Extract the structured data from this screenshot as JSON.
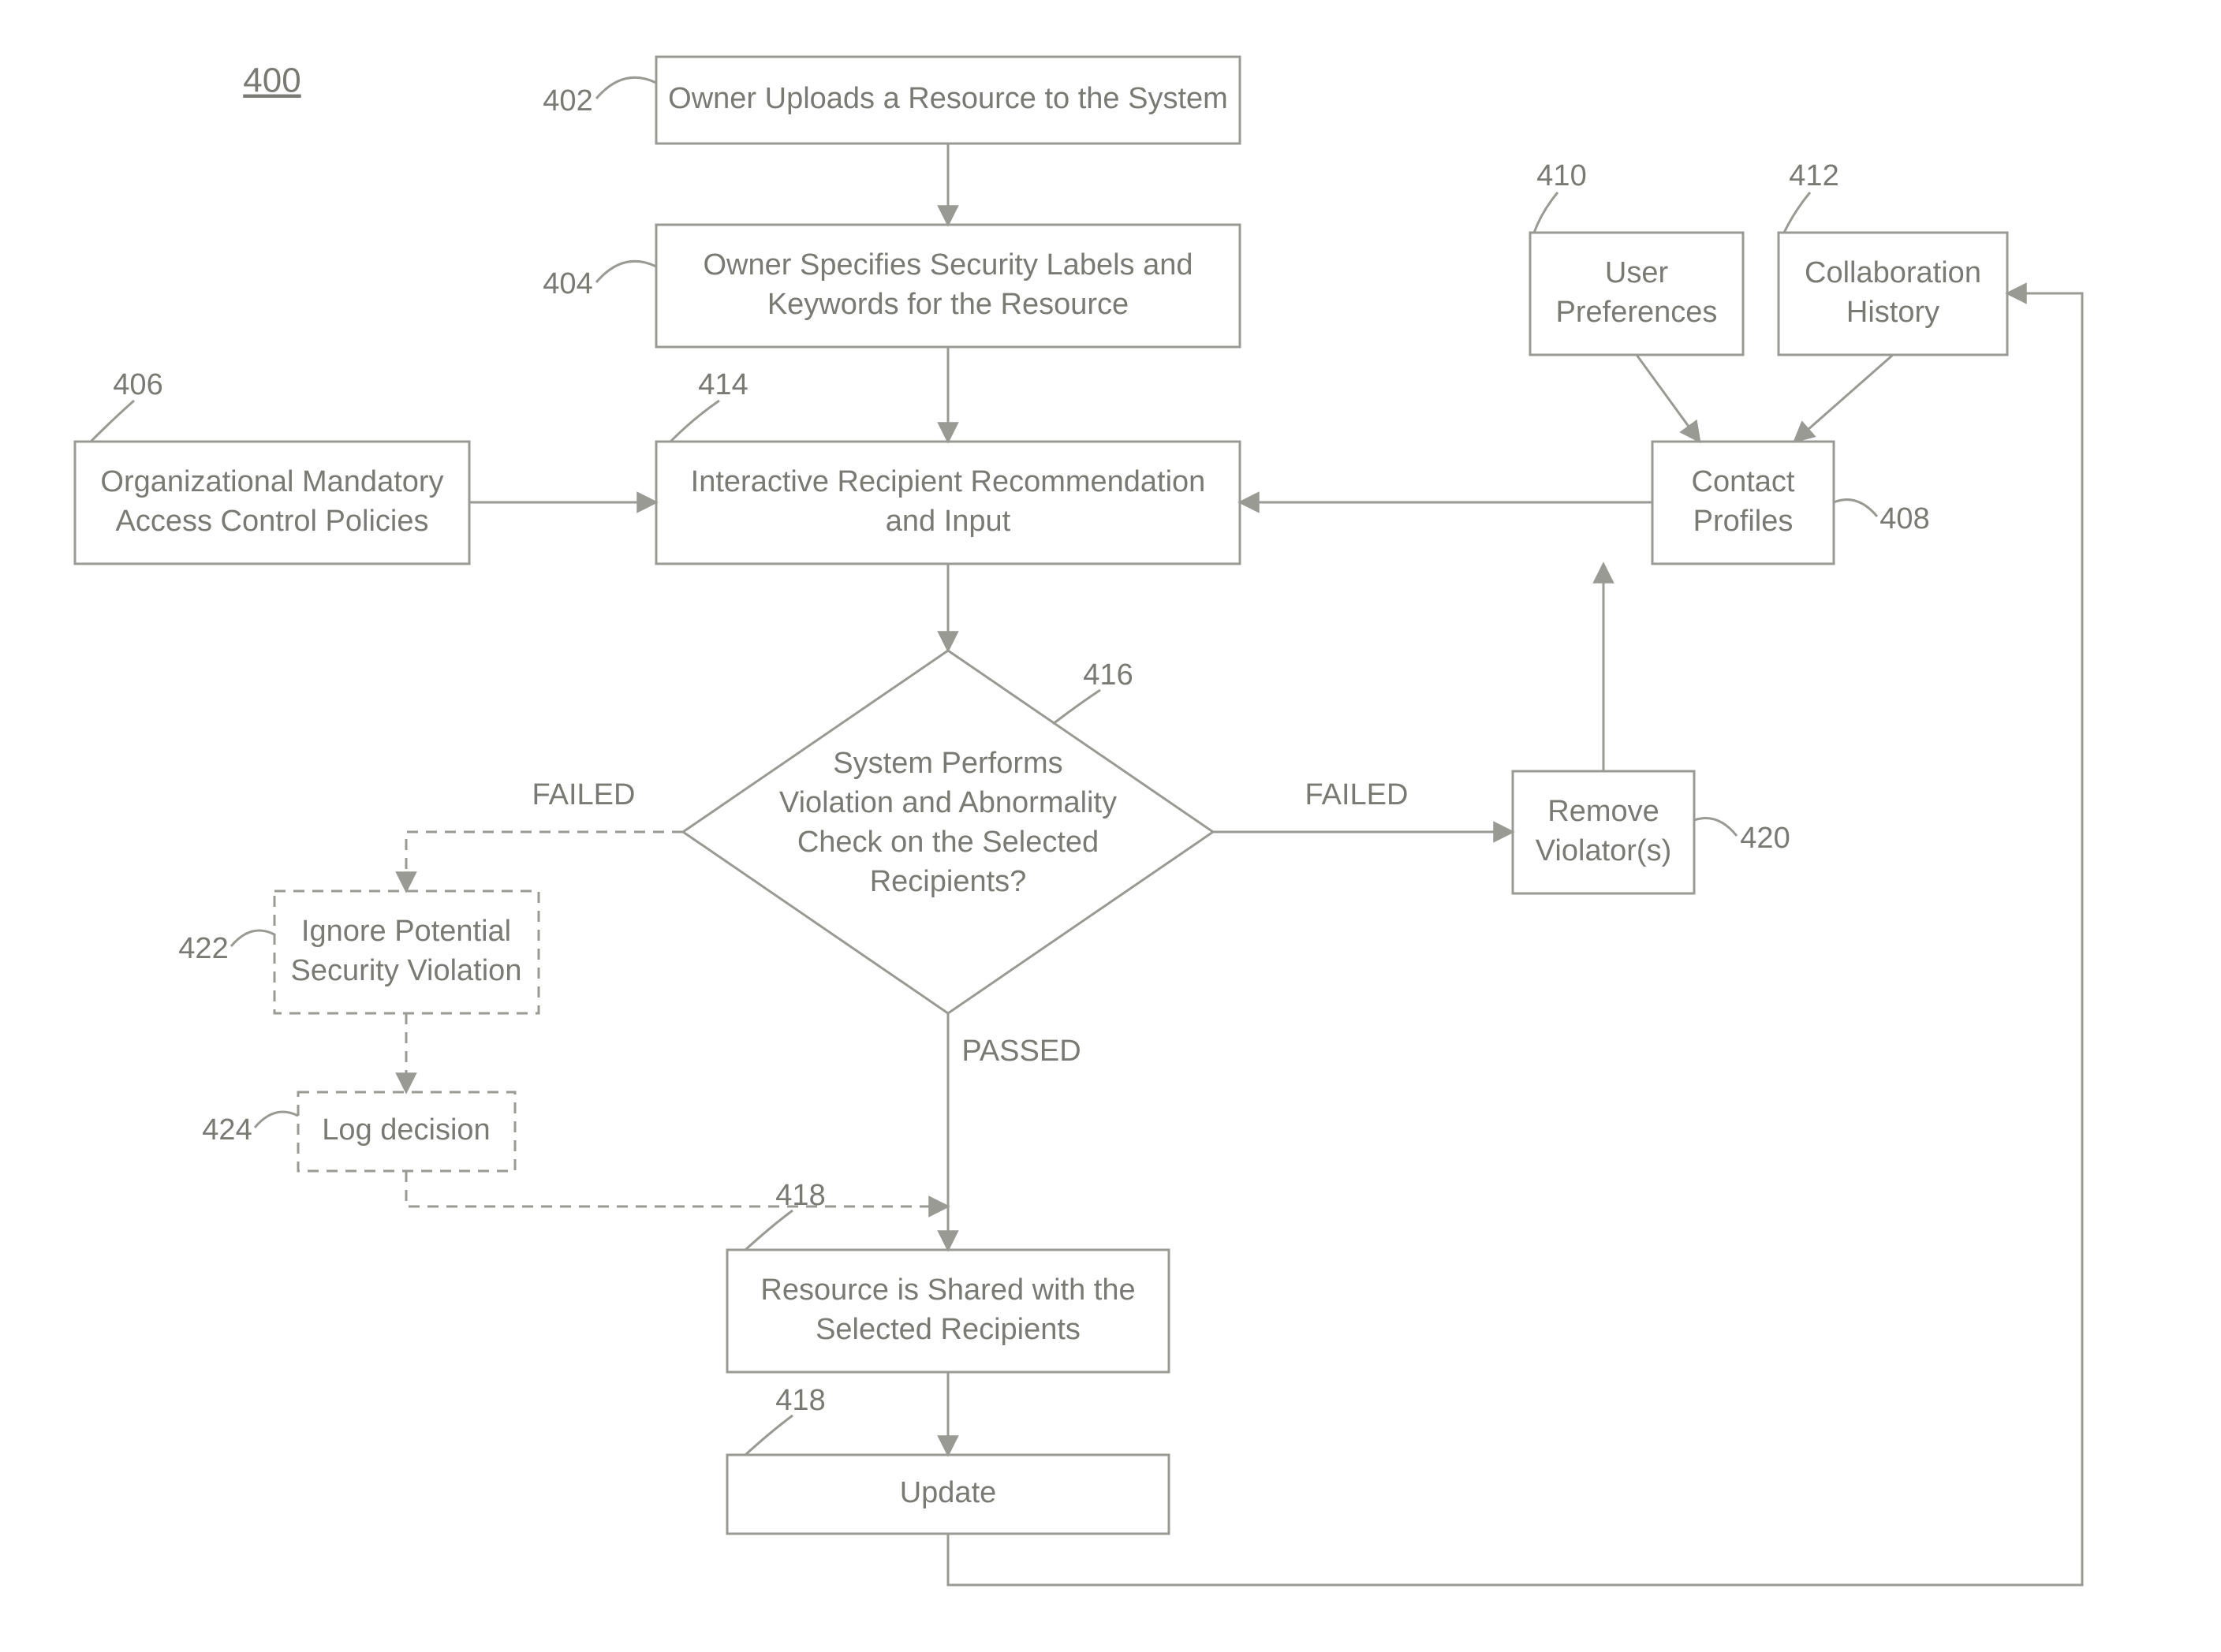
{
  "figure_ref": "400",
  "nodes": {
    "n402": {
      "ref": "402",
      "text": [
        "Owner Uploads a Resource to the System"
      ]
    },
    "n404": {
      "ref": "404",
      "text": [
        "Owner Specifies Security Labels and",
        "Keywords for the Resource"
      ]
    },
    "n406": {
      "ref": "406",
      "text": [
        "Organizational Mandatory",
        "Access Control Policies"
      ]
    },
    "n414": {
      "ref": "414",
      "text": [
        "Interactive Recipient Recommendation",
        "and Input"
      ]
    },
    "n408": {
      "ref": "408",
      "text": [
        "Contact",
        "Profiles"
      ]
    },
    "n410": {
      "ref": "410",
      "text": [
        "User",
        "Preferences"
      ]
    },
    "n412": {
      "ref": "412",
      "text": [
        "Collaboration",
        "History"
      ]
    },
    "n416": {
      "ref": "416",
      "text": [
        "System Performs",
        "Violation and Abnormality",
        "Check on the Selected",
        "Recipients?"
      ]
    },
    "n420": {
      "ref": "420",
      "text": [
        "Remove",
        "Violator(s)"
      ]
    },
    "n422": {
      "ref": "422",
      "text": [
        "Ignore Potential",
        "Security Violation"
      ]
    },
    "n424": {
      "ref": "424",
      "text": [
        "Log decision"
      ]
    },
    "n418a": {
      "ref": "418",
      "text": [
        "Resource is Shared with the",
        "Selected Recipients"
      ]
    },
    "n418b": {
      "ref": "418",
      "text": [
        "Update"
      ]
    }
  },
  "decision_labels": {
    "passed": "PASSED",
    "failed_left": "FAILED",
    "failed_right": "FAILED"
  }
}
